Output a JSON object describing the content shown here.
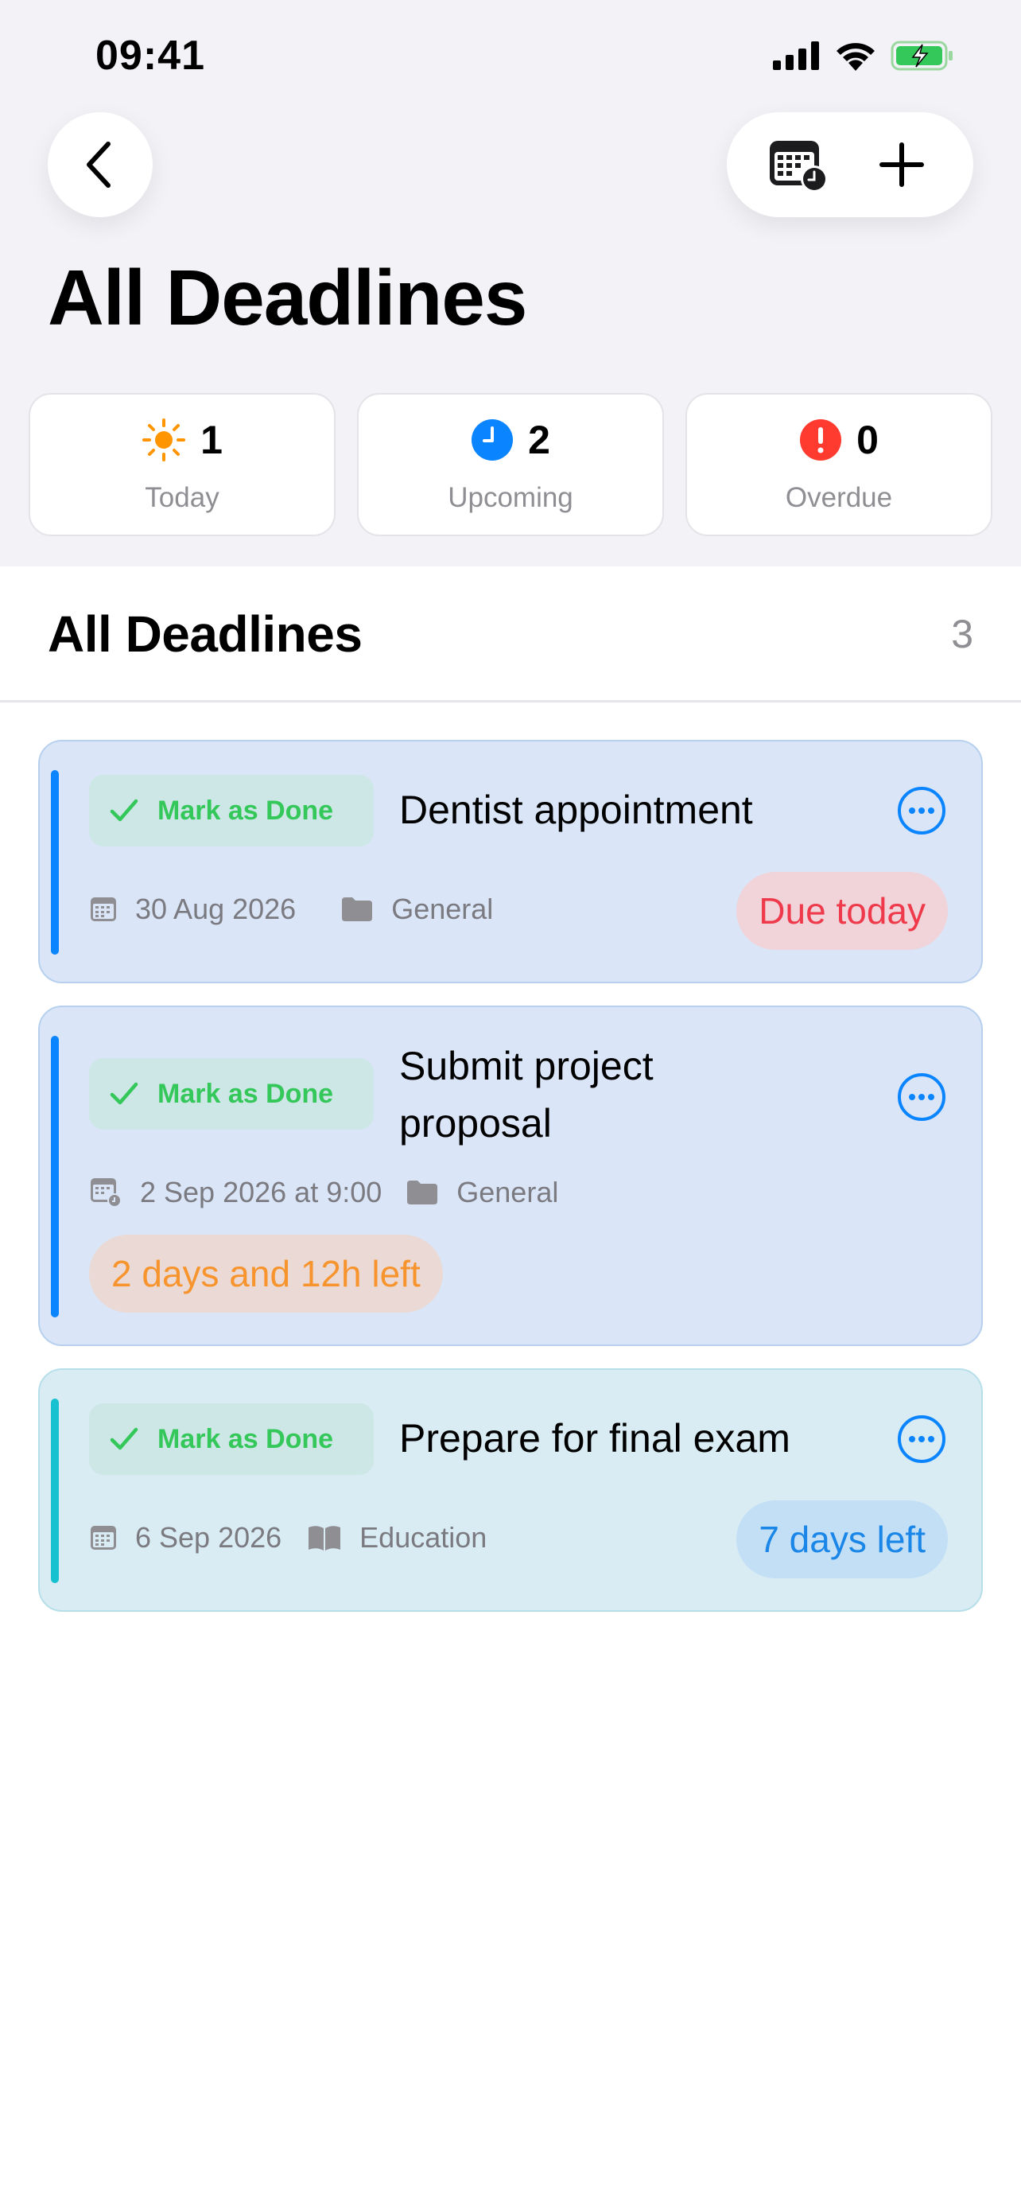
{
  "status_bar": {
    "time": "09:41"
  },
  "header": {
    "title": "All Deadlines",
    "back_icon": "chevron-left-icon",
    "calendar_icon": "calendar-clock-icon",
    "add_icon": "plus-icon"
  },
  "stats": [
    {
      "icon": "sun-icon",
      "count": "1",
      "label": "Today",
      "color": "#ff9500"
    },
    {
      "icon": "clock-icon",
      "count": "2",
      "label": "Upcoming",
      "color": "#0a84ff"
    },
    {
      "icon": "exclamation-icon",
      "count": "0",
      "label": "Overdue",
      "color": "#ff3b30"
    }
  ],
  "section": {
    "title": "All Deadlines",
    "count": "3"
  },
  "deadlines": [
    {
      "done_label": "Mark as Done",
      "title": "Dentist appointment",
      "date": "30 Aug 2026",
      "category": "General",
      "category_icon": "folder-icon",
      "badge": "Due today",
      "badge_color": "#ee3a4a",
      "accent_color": "#0a84ff"
    },
    {
      "done_label": "Mark as Done",
      "title": "Submit project proposal",
      "title_line1": "Submit project",
      "title_line2": "proposal",
      "date": "2 Sep 2026 at 9:00",
      "category": "General",
      "category_icon": "folder-icon",
      "badge": "2 days and 12h left",
      "badge_color": "#f7942d",
      "accent_color": "#0a84ff"
    },
    {
      "done_label": "Mark as Done",
      "title": "Prepare for final exam",
      "date": "6 Sep 2026",
      "category": "Education",
      "category_icon": "book-icon",
      "badge": "7 days left",
      "badge_color": "#1a86e8",
      "accent_color": "#17c1d0"
    }
  ]
}
